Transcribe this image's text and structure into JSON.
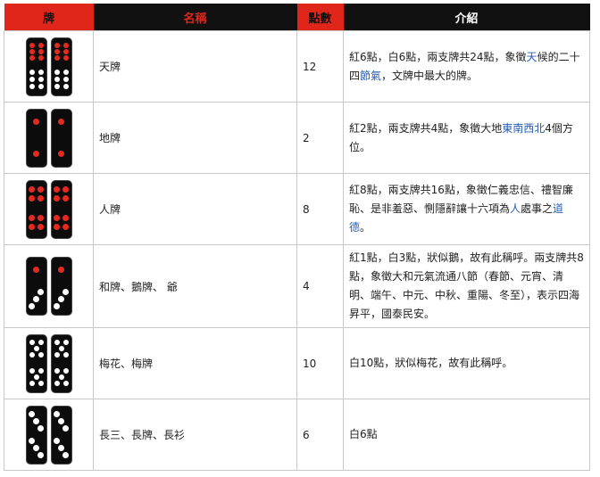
{
  "headers": {
    "tile": "牌",
    "name": "名稱",
    "points": "點數",
    "intro": "介紹"
  },
  "rows": [
    {
      "name": "天牌",
      "points": "12",
      "desc_parts": [
        {
          "t": "紅6點，白6點，兩支牌共24點，象徵"
        },
        {
          "t": "天",
          "link": true
        },
        {
          "t": "候的二十四"
        },
        {
          "t": "節氣",
          "link": true
        },
        {
          "t": "，文牌中最大的牌。"
        }
      ],
      "tile_icon": "heaven-tile-icon"
    },
    {
      "name": "地牌",
      "points": "2",
      "desc_parts": [
        {
          "t": "紅2點，兩支牌共4點，象徵大地"
        },
        {
          "t": "東南西北",
          "link": true
        },
        {
          "t": "4個方位。"
        }
      ],
      "tile_icon": "earth-tile-icon"
    },
    {
      "name": "人牌",
      "points": "8",
      "desc_parts": [
        {
          "t": "紅8點，兩支牌共16點，象徵仁義忠信、禮智廉恥、是非羞惡、惻隱辭讓十六項為"
        },
        {
          "t": "人",
          "link": true
        },
        {
          "t": "處事之"
        },
        {
          "t": "道德",
          "link": true
        },
        {
          "t": "。"
        }
      ],
      "tile_icon": "human-tile-icon"
    },
    {
      "name": "和牌、鵝牌、 爺",
      "points": "4",
      "desc_parts": [
        {
          "t": "紅1點，白3點，狀似鵝，故有此稱呼。兩支牌共8點，象徵大和元氣流通八節（春節、元宵、清明、端午、中元、中秋、重陽、冬至），表示四海昇平，國泰民安。"
        }
      ],
      "tile_icon": "goose-tile-icon"
    },
    {
      "name": "梅花、梅牌",
      "points": "10",
      "desc_parts": [
        {
          "t": "白10點，狀似梅花，故有此稱呼。"
        }
      ],
      "tile_icon": "plum-tile-icon"
    },
    {
      "name": "長三、長牌、長衫",
      "points": "6",
      "desc_parts": [
        {
          "t": "白6點"
        }
      ],
      "tile_icon": "long-three-tile-icon"
    }
  ],
  "colors": {
    "header_red": "#e0261b",
    "header_dark": "#111111",
    "pip_red": "#e32b22",
    "pip_white": "#ffffff",
    "link": "#2a5db0"
  }
}
